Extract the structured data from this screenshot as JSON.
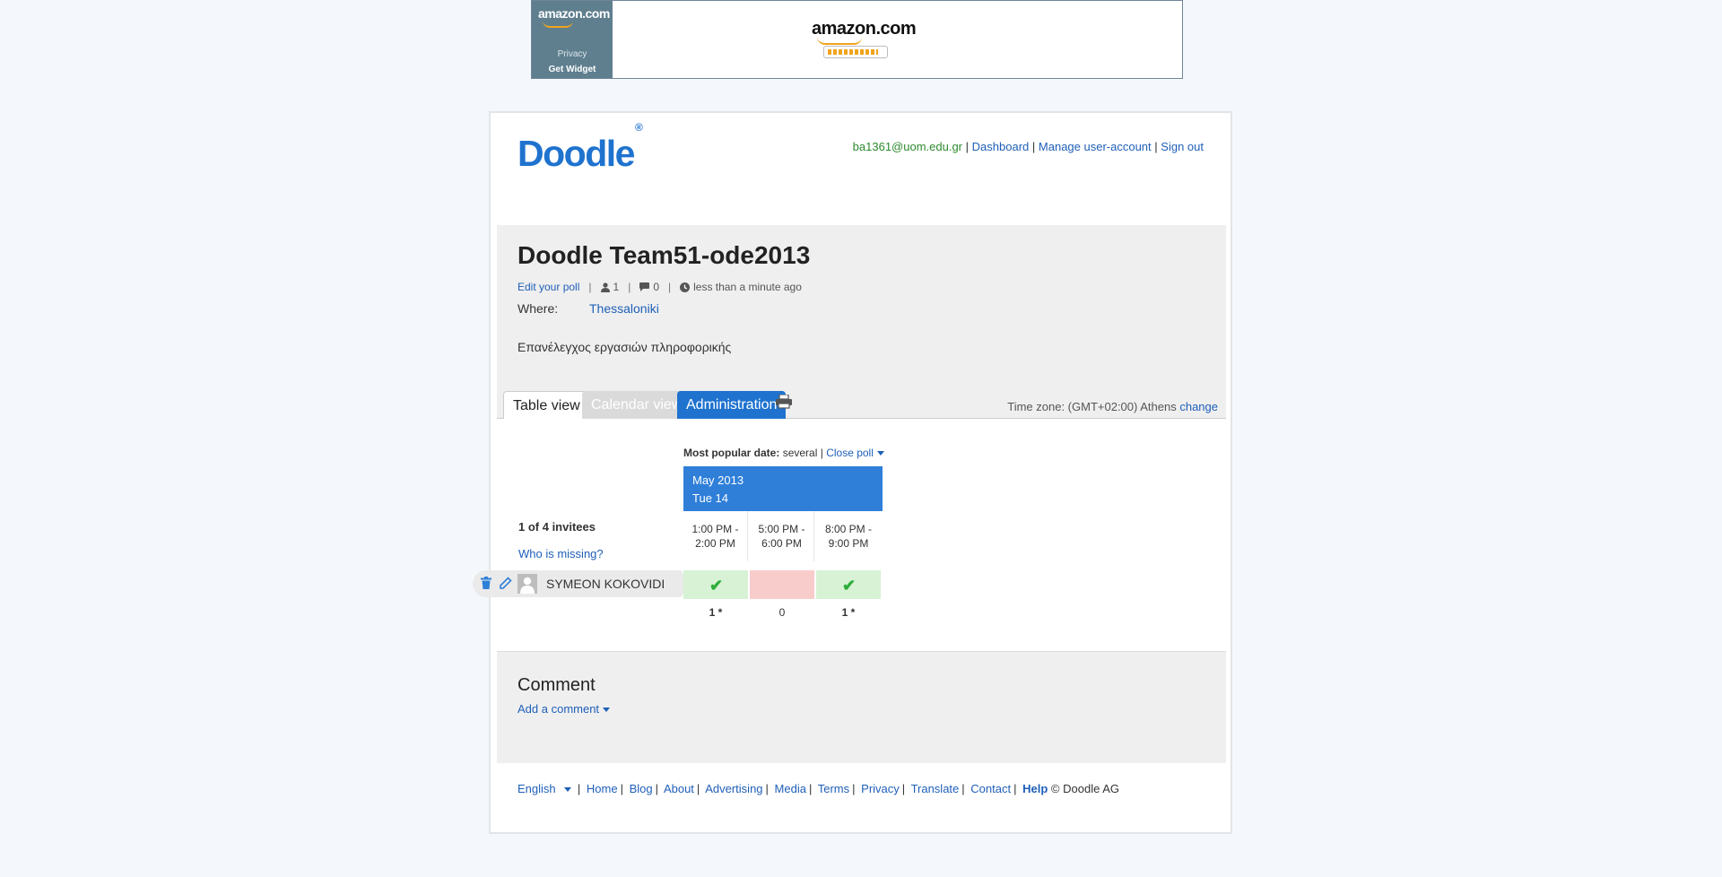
{
  "ad": {
    "side_logo": "amazon.com",
    "privacy": "Privacy",
    "get_widget": "Get Widget",
    "main_logo": "amazon.com",
    "loading": 0.9
  },
  "brand": "Doodle",
  "brand_mark": "®",
  "userbar": {
    "email": "ba1361@uom.edu.gr",
    "dashboard": "Dashboard",
    "manage": "Manage user-account",
    "signout": "Sign out",
    "sep": "|"
  },
  "poll": {
    "title": "Doodle Team51-ode2013",
    "edit": "Edit your poll",
    "participants": "1",
    "comments": "0",
    "time_ago": "less than a minute ago",
    "where_label": "Where:",
    "where_value": "Thessaloniki",
    "description": "Επανέλεγχος εργασιών πληροφορικής"
  },
  "tabs": {
    "table": "Table view",
    "calendar": "Calendar view",
    "admin": "Administration",
    "timezone": "Time zone: (GMT+02:00) Athens",
    "change": "change"
  },
  "table": {
    "popular_label": "Most popular date:",
    "popular_value": "several",
    "close_poll": "Close poll",
    "month": "May 2013",
    "day": "Tue 14",
    "times": [
      {
        "start": "1:00 PM -",
        "end": "2:00 PM"
      },
      {
        "start": "5:00 PM -",
        "end": "6:00 PM"
      },
      {
        "start": "8:00 PM -",
        "end": "9:00 PM"
      }
    ],
    "invitees": "1 of 4 invitees",
    "missing": "Who is missing?",
    "participant": "SYMEON KOKOVIDI",
    "votes": [
      "yes",
      "no",
      "yes"
    ],
    "counts": [
      "1 *",
      "0",
      "1 *"
    ]
  },
  "comment": {
    "title": "Comment",
    "add": "Add a comment"
  },
  "footer": {
    "language": "English",
    "links": [
      "Home",
      "Blog",
      "About",
      "Advertising",
      "Media",
      "Terms",
      "Privacy",
      "Translate",
      "Contact"
    ],
    "help": "Help",
    "copyright": "© Doodle AG"
  },
  "colors": {
    "brand": "#1f73cf",
    "header_blue": "#2f7fd9",
    "yes": "#d7f2d5",
    "no": "#f9cccc",
    "email": "#2d8a2d"
  }
}
